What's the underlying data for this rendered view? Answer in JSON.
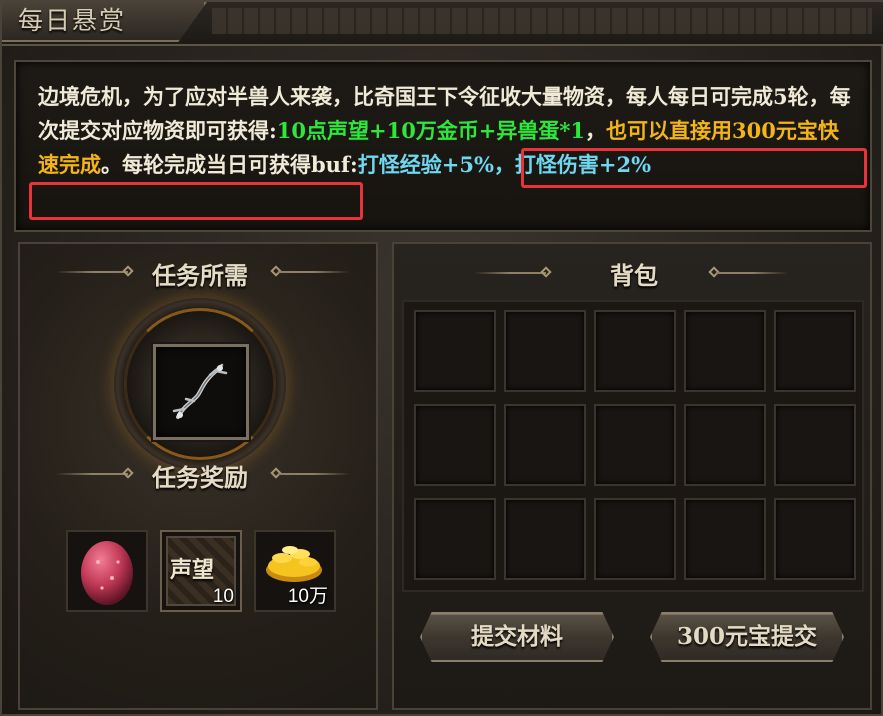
{
  "window": {
    "title": "每日悬赏",
    "close_glyph": "×"
  },
  "description": {
    "segments": [
      {
        "text": "边境危机，为了应对半兽人来袭，比奇国王下令征收大量物资，每人每日可完成5轮，每次提交对应物资即可获得:",
        "color": "white"
      },
      {
        "text": "10点声望+10万金币+异兽蛋*1",
        "color": "green"
      },
      {
        "text": "，",
        "color": "white"
      },
      {
        "text": "也可以直接用300元宝快速完成",
        "color": "orange"
      },
      {
        "text": "。",
        "color": "white"
      },
      {
        "text": "每轮完成当日可获得buf:",
        "color": "white"
      },
      {
        "text": "打怪经验+5%，打怪伤害+2%",
        "color": "cyan"
      }
    ]
  },
  "left_panel": {
    "required_title": "任务所需",
    "required_item": {
      "icon": "bone-whip-icon"
    },
    "reward_title": "任务奖励",
    "rewards": [
      {
        "icon": "monster-egg-icon",
        "count": ""
      },
      {
        "icon": "reputation-icon",
        "label": "声望",
        "count": "10"
      },
      {
        "icon": "gold-coins-icon",
        "count": "10万"
      }
    ]
  },
  "bag": {
    "title": "背包",
    "rows": 3,
    "cols": 5
  },
  "buttons": {
    "submit_label": "提交材料",
    "ingot_submit_label": "300元宝提交"
  },
  "colors": {
    "green": "#2fe63a",
    "orange": "#f3b418",
    "cyan": "#6fd7f0",
    "highlight_border": "#e8333a"
  }
}
